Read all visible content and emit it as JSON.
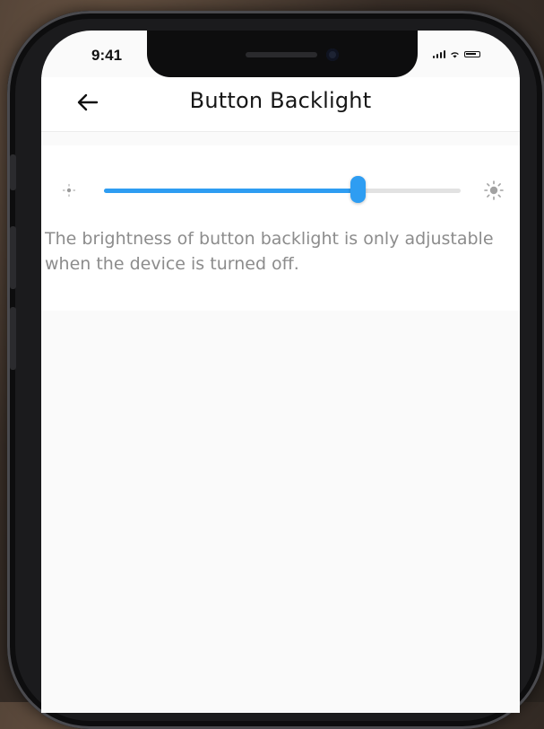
{
  "status_bar": {
    "time": "9:41",
    "icons": [
      "signal-icon",
      "wifi-icon",
      "battery-icon"
    ]
  },
  "header": {
    "back_icon": "arrow-left-icon",
    "title": "Button Backlight"
  },
  "brightness": {
    "min_icon": "sun-dim-icon",
    "max_icon": "sun-bright-icon",
    "level": 0.71,
    "accent_color": "#2E9DF2",
    "track_color": "#E2E2E2",
    "description": "The brightness of button backlight is only adjustable when the device is turned off."
  }
}
